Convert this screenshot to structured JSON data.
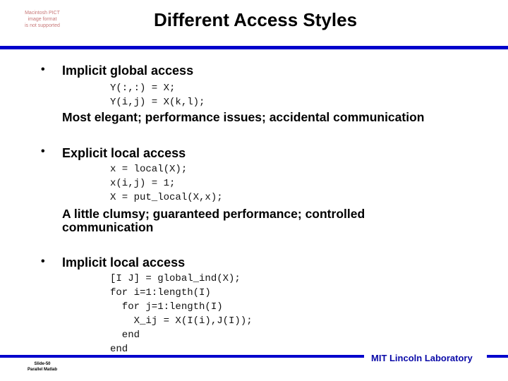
{
  "placeholder_image": {
    "lines": [
      "Macintosh PICT",
      "image format",
      "is not supported"
    ]
  },
  "slide": {
    "title": "Different Access Styles",
    "accent_color": "#0000cc"
  },
  "sections": [
    {
      "bullet": "•",
      "heading": "Implicit global access",
      "code": [
        "Y(:,:) = X;",
        "Y(i,j) = X(k,l);"
      ],
      "note": "Most elegant; performance issues; accidental communication"
    },
    {
      "bullet": "•",
      "heading": "Explicit local access",
      "code": [
        "x = local(X);",
        "x(i,j) = 1;",
        "X = put_local(X,x);"
      ],
      "note": "A little clumsy; guaranteed performance; controlled communication"
    },
    {
      "bullet": "•",
      "heading": "Implicit local access",
      "code": [
        "[I J] = global_ind(X);",
        "for i=1:length(I)",
        "  for j=1:length(I)",
        "    X_ij = X(I(i),J(I));",
        "  end",
        "end"
      ]
    }
  ],
  "footer": {
    "slide_number": "Slide-50",
    "deck_name": "Parallel Matlab",
    "organization": "MIT Lincoln Laboratory"
  }
}
